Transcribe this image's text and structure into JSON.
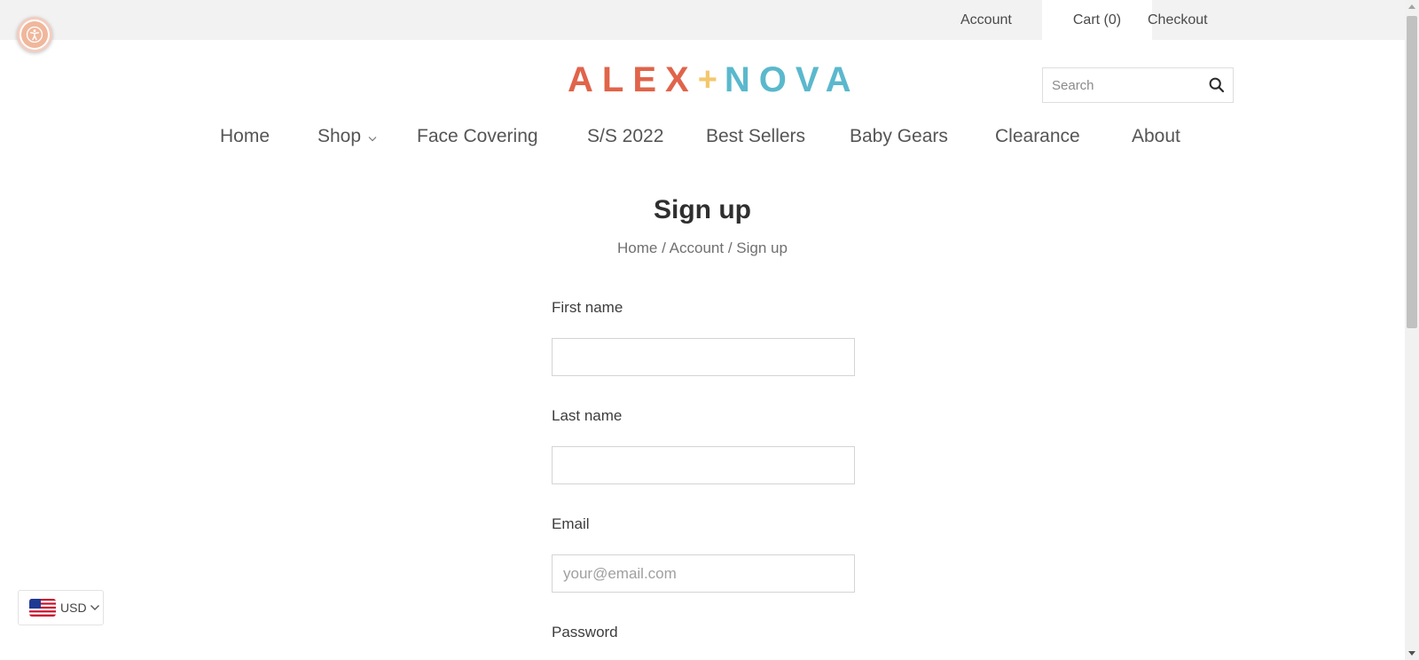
{
  "topbar": {
    "account": "Account",
    "cart": "Cart (0)",
    "checkout": "Checkout"
  },
  "logo": {
    "part1": "ALEX",
    "plus": "+",
    "part2": "NOVA"
  },
  "search": {
    "placeholder": "Search"
  },
  "nav": {
    "items": [
      "Home",
      "Shop",
      "Face Covering",
      "S/S 2022",
      "Best Sellers",
      "Baby Gears",
      "Clearance",
      "About"
    ]
  },
  "page": {
    "title": "Sign up",
    "breadcrumb": [
      "Home",
      "Account",
      "Sign up"
    ],
    "separator": "/"
  },
  "form": {
    "first_name_label": "First name",
    "last_name_label": "Last name",
    "email_label": "Email",
    "email_placeholder": "your@email.com",
    "password_label": "Password"
  },
  "currency": {
    "code": "USD"
  },
  "colors": {
    "logo_primary": "#e0644a",
    "logo_plus": "#f4c76d",
    "logo_secondary": "#5ab8cd",
    "accessibility_button": "#f0b79c"
  },
  "icons": {
    "accessibility": "accessibility-icon",
    "search": "search-icon",
    "chevron": "chevron-down-icon",
    "flag": "us-flag-icon"
  }
}
